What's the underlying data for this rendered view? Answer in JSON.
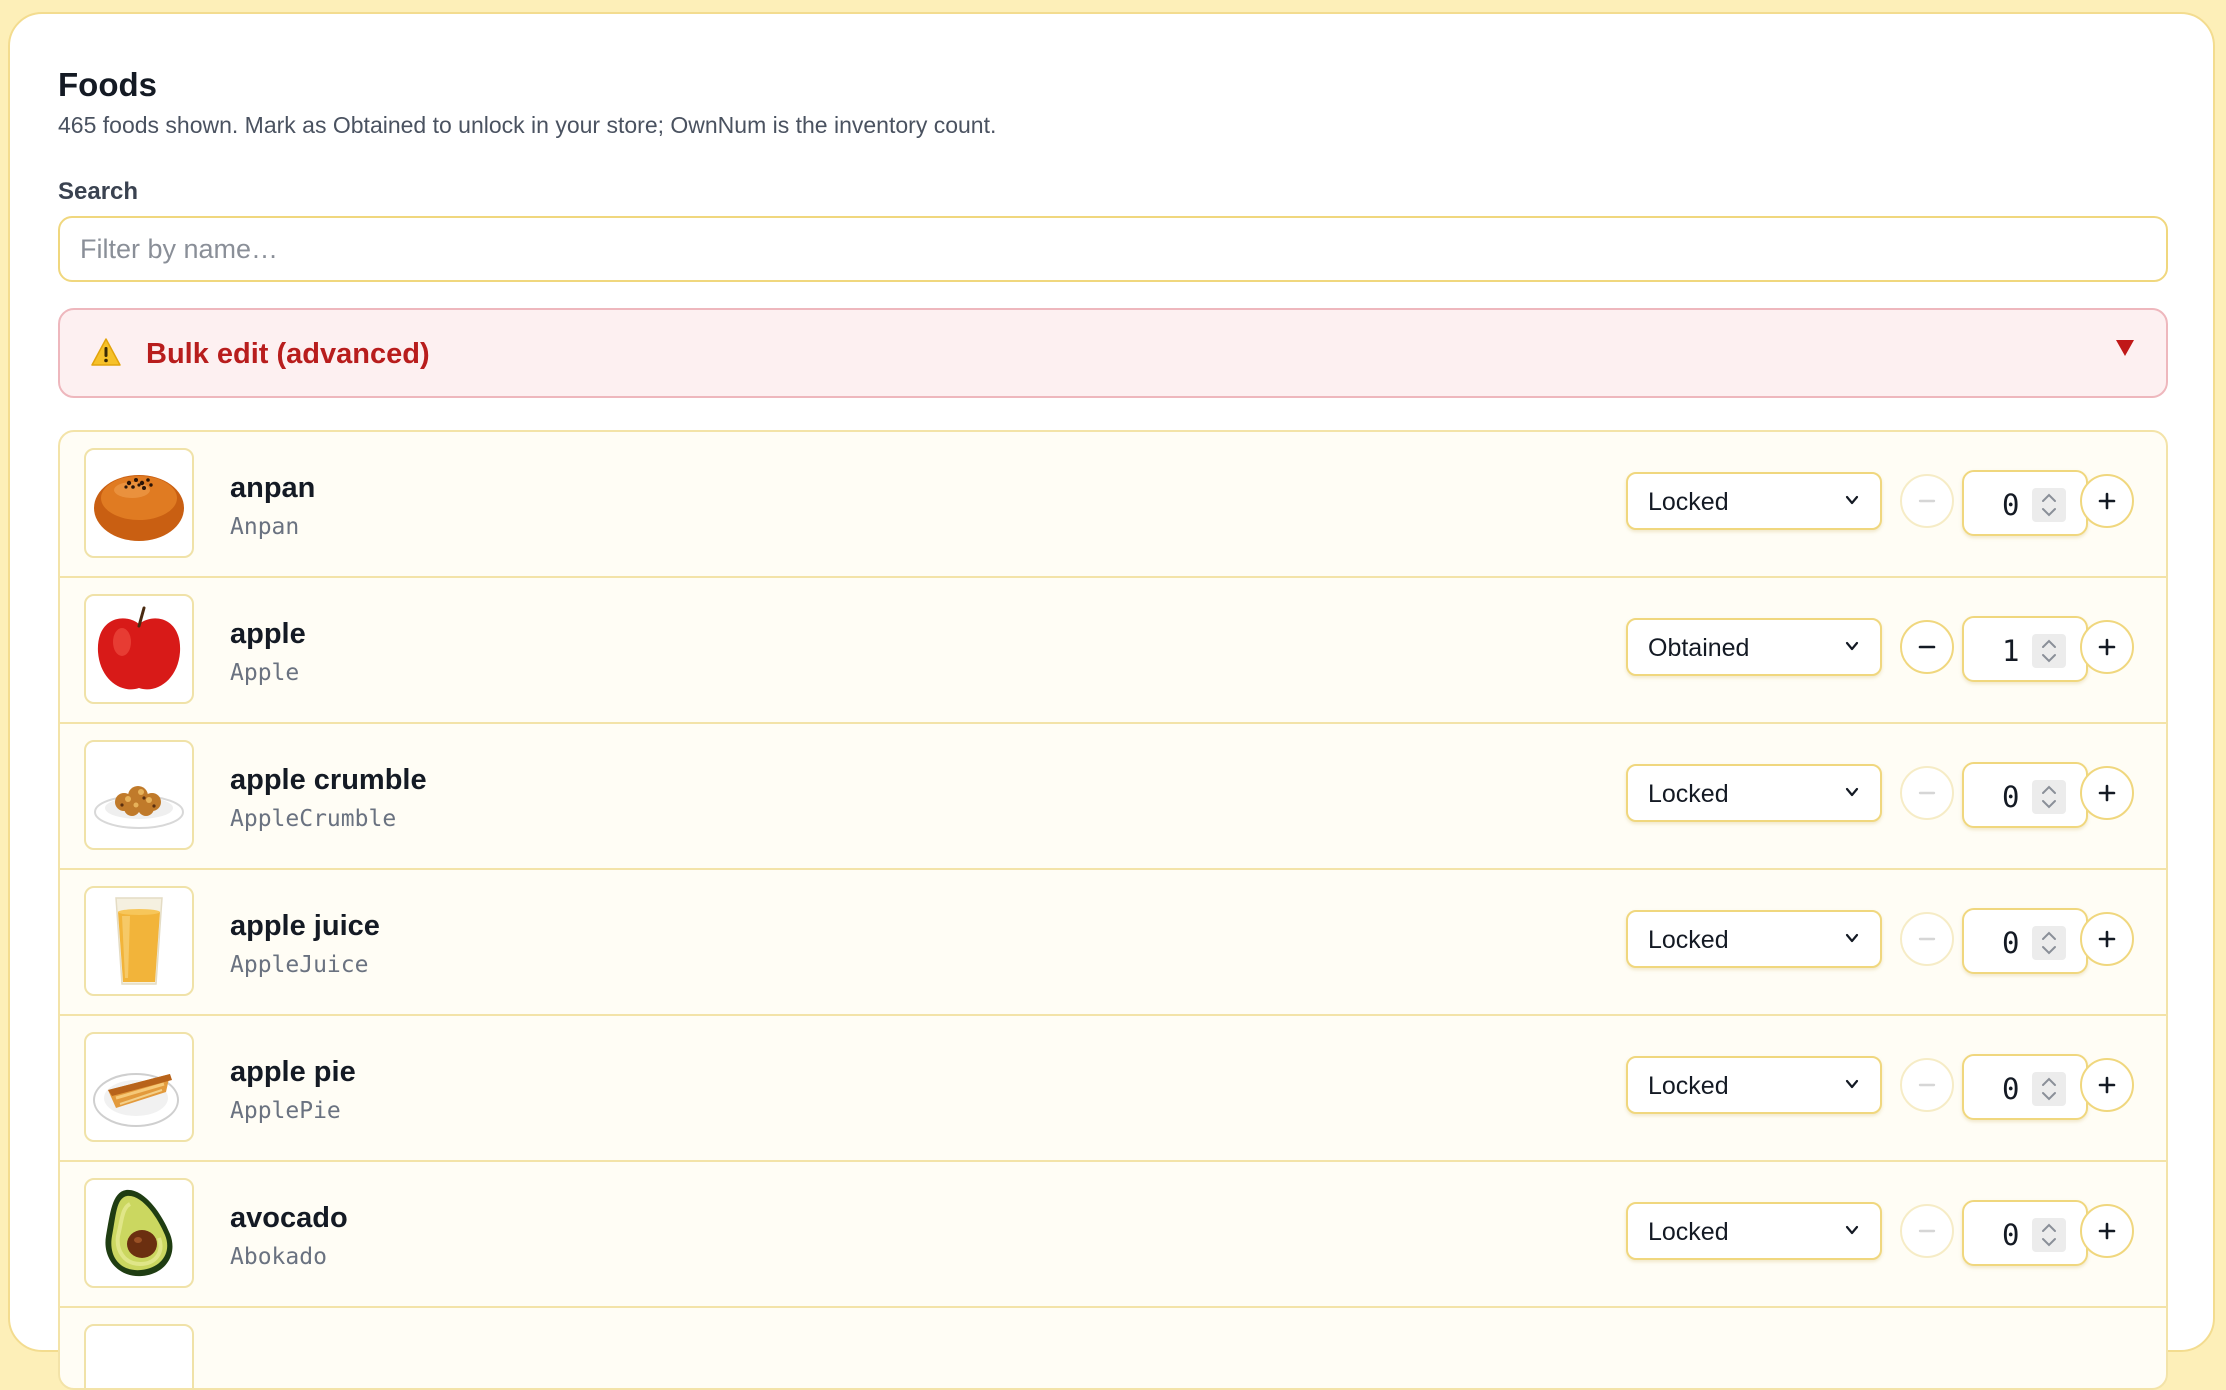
{
  "header": {
    "title": "Foods",
    "subtitle": "465 foods shown. Mark as Obtained to unlock in your store; OwnNum is the inventory count."
  },
  "search": {
    "label": "Search",
    "placeholder": "Filter by name…",
    "value": ""
  },
  "bulk_edit": {
    "label": "Bulk edit (advanced)",
    "icon": "warning-icon",
    "expand_icon": "triangle-down-icon",
    "accent_color": "#b81d1d"
  },
  "foods": [
    {
      "name": "anpan",
      "code": "Anpan",
      "status": "Locked",
      "count": "0",
      "icon": "anpan-image"
    },
    {
      "name": "apple",
      "code": "Apple",
      "status": "Obtained",
      "count": "1",
      "icon": "apple-image"
    },
    {
      "name": "apple crumble",
      "code": "AppleCrumble",
      "status": "Locked",
      "count": "0",
      "icon": "apple-crumble-image"
    },
    {
      "name": "apple juice",
      "code": "AppleJuice",
      "status": "Locked",
      "count": "0",
      "icon": "apple-juice-image"
    },
    {
      "name": "apple pie",
      "code": "ApplePie",
      "status": "Locked",
      "count": "0",
      "icon": "apple-pie-image"
    },
    {
      "name": "avocado",
      "code": "Abokado",
      "status": "Locked",
      "count": "0",
      "icon": "avocado-image"
    }
  ],
  "colors": {
    "background": "#fdefb8",
    "border": "#f0d77e",
    "text": "#141a24"
  }
}
